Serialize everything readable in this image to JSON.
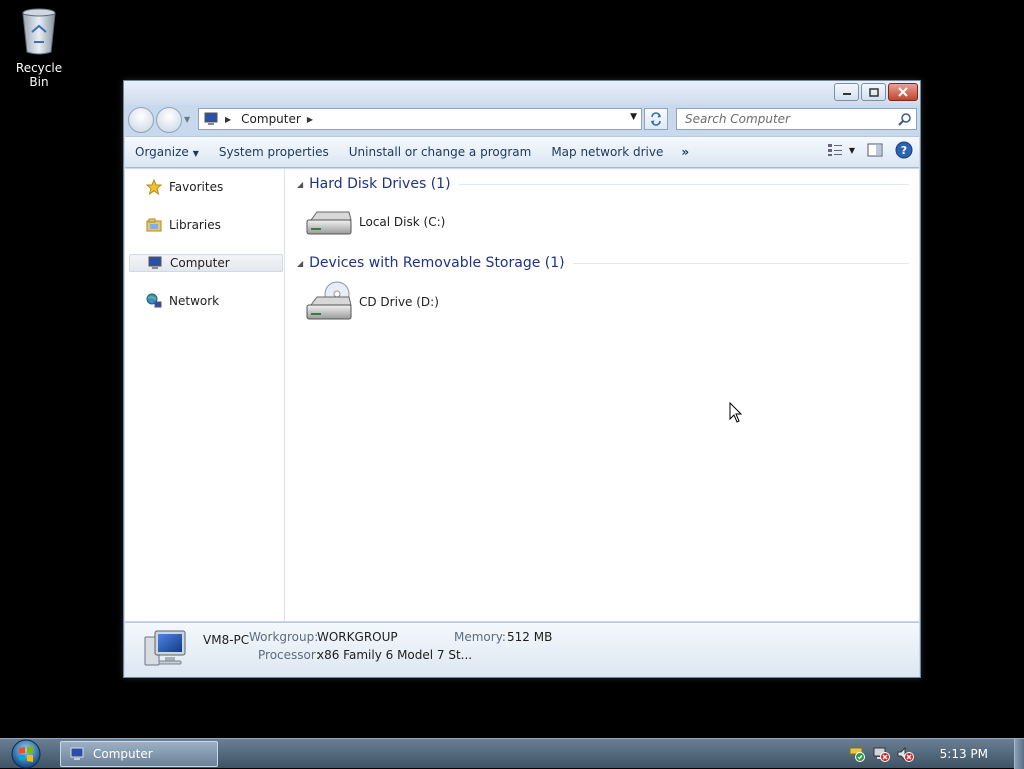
{
  "desktop": {
    "icons": [
      {
        "label": "Recycle Bin",
        "icon": "recycle-bin-icon"
      }
    ]
  },
  "window": {
    "address": {
      "crumbs": [
        "Computer"
      ]
    },
    "search": {
      "placeholder": "Search Computer"
    },
    "commands": {
      "organize": "Organize",
      "system_properties": "System properties",
      "uninstall": "Uninstall or change a program",
      "map_drive": "Map network drive",
      "more": "»"
    },
    "nav": {
      "items": [
        {
          "label": "Favorites",
          "icon": "favorites-star-icon"
        },
        {
          "label": "Libraries",
          "icon": "libraries-icon"
        },
        {
          "label": "Computer",
          "icon": "computer-icon",
          "selected": true
        },
        {
          "label": "Network",
          "icon": "network-icon"
        }
      ]
    },
    "groups": [
      {
        "title": "Hard Disk Drives (1)",
        "items": [
          {
            "label": "Local Disk (C:)",
            "icon": "hard-disk-icon"
          }
        ]
      },
      {
        "title": "Devices with Removable Storage (1)",
        "items": [
          {
            "label": "CD Drive (D:)",
            "icon": "cd-drive-icon"
          }
        ]
      }
    ],
    "details": {
      "pc_name": "VM8-PC",
      "workgroup_label": "Workgroup:",
      "workgroup_value": "WORKGROUP",
      "memory_label": "Memory:",
      "memory_value": "512 MB",
      "processor_label": "Processor:",
      "processor_value": "x86 Family 6 Model 7 St..."
    }
  },
  "taskbar": {
    "button_label": "Computer",
    "clock": "5:13 PM"
  },
  "colors": {
    "group_title": "#1e3287",
    "command_text": "#1e395b",
    "close_button": "#c2452f"
  }
}
